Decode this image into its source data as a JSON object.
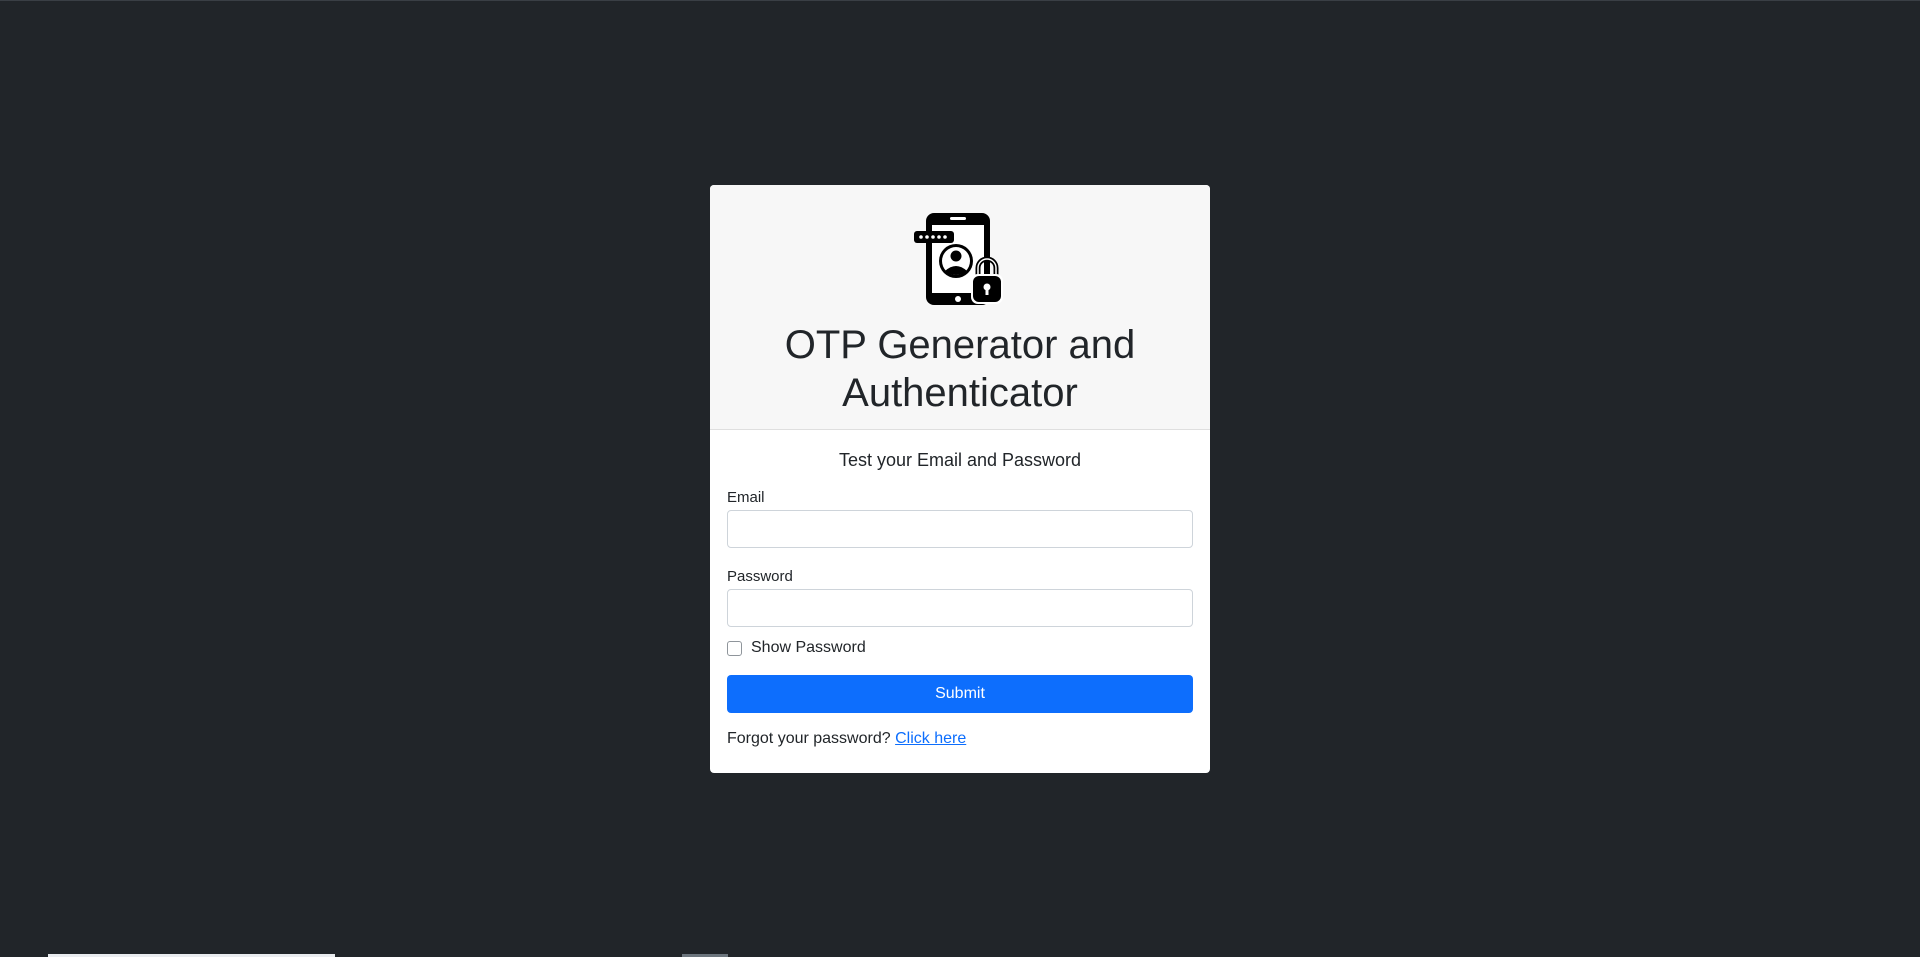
{
  "header": {
    "logo_icon": "phone-otp-lock-icon",
    "title": "OTP Generator and Authenticator"
  },
  "form": {
    "subtitle": "Test your Email and Password",
    "email_label": "Email",
    "email_value": "",
    "password_label": "Password",
    "password_value": "",
    "show_password_label": "Show Password",
    "show_password_checked": false,
    "submit_label": "Submit",
    "forgot_text": "Forgot your password?",
    "forgot_link": "Click here"
  },
  "colors": {
    "background": "#212529",
    "primary": "#0d6efd",
    "header_bg": "#f7f7f7"
  }
}
